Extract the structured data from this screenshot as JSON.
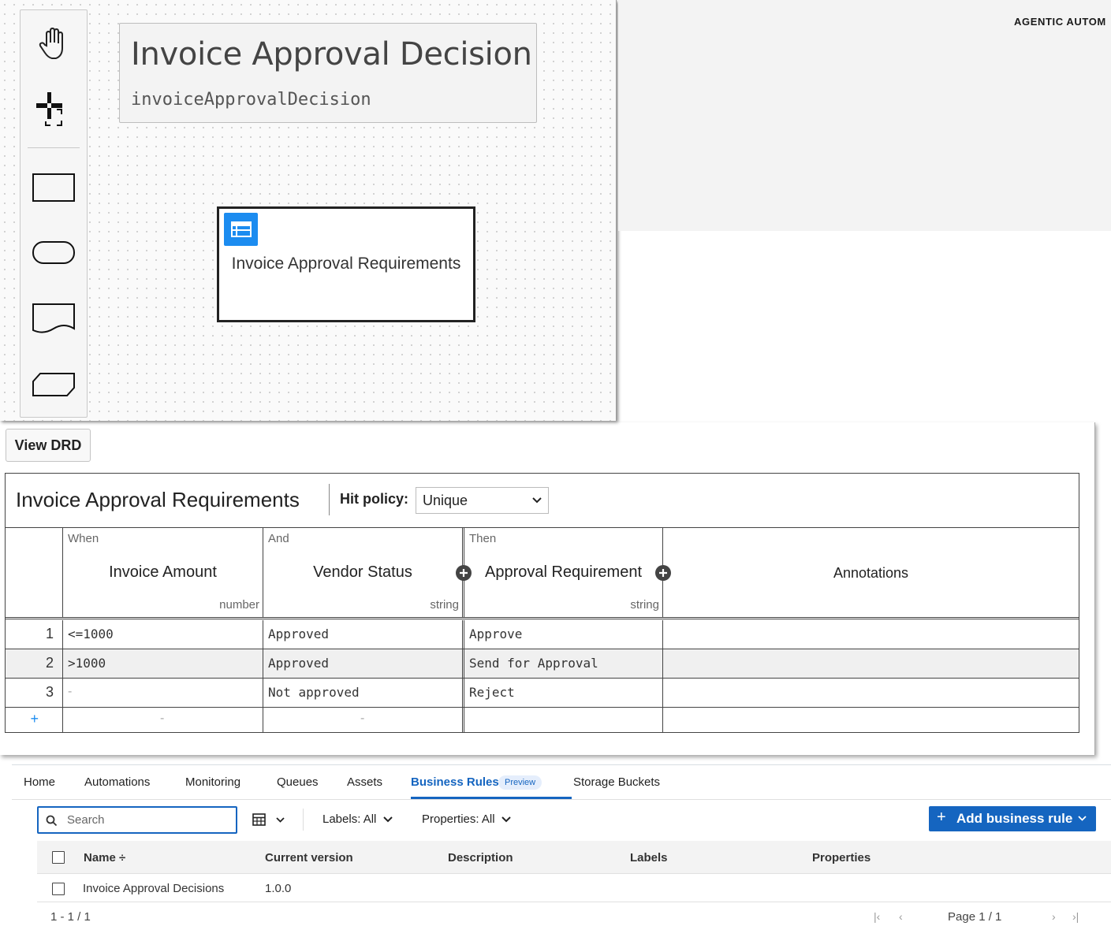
{
  "brand": {
    "tagline": "AGENTIC AUTOM"
  },
  "drd": {
    "definition_name": "Invoice Approval Decision",
    "definition_id": "invoiceApprovalDecision",
    "decision_label": "Invoice Approval Requirements"
  },
  "palette": {
    "tools": [
      "hand-tool-icon",
      "lasso-tool-icon",
      "decision-shape-icon",
      "input-data-shape-icon",
      "knowledge-source-shape-icon",
      "business-knowledge-shape-icon"
    ]
  },
  "view_drd_label": "View DRD",
  "decision_table": {
    "name": "Invoice Approval Requirements",
    "hit_policy_label": "Hit policy:",
    "hit_policy_value": "Unique",
    "columns": [
      {
        "kind": "When",
        "title": "Invoice Amount",
        "type": "number"
      },
      {
        "kind": "And",
        "title": "Vendor Status",
        "type": "string"
      },
      {
        "kind": "Then",
        "title": "Approval Requirement",
        "type": "string"
      },
      {
        "kind": "",
        "title": "Annotations",
        "type": ""
      }
    ],
    "rows": [
      {
        "index": "1",
        "cells": [
          "<=1000",
          "Approved",
          "Approve",
          ""
        ]
      },
      {
        "index": "2",
        "cells": [
          ">1000",
          "Approved",
          "Send for Approval",
          ""
        ]
      },
      {
        "index": "3",
        "cells": [
          "-",
          "Not approved",
          "Reject",
          ""
        ]
      }
    ],
    "add_row_symbol": "+",
    "empty_placeholder": "-"
  },
  "orchestrator": {
    "tabs": [
      "Home",
      "Automations",
      "Monitoring",
      "Queues",
      "Assets",
      "Business Rules",
      "Storage Buckets"
    ],
    "active_tab": "Business Rules",
    "preview_badge": "Preview",
    "search_placeholder": "Search",
    "labels_filter": "Labels: All",
    "properties_filter": "Properties: All",
    "add_button": "Add business rule",
    "columns": [
      "Name ÷",
      "Current version",
      "Description",
      "Labels",
      "Properties"
    ],
    "rows": [
      {
        "name": "Invoice Approval Decisions",
        "version": "1.0.0",
        "description": "",
        "labels": "",
        "properties": ""
      }
    ],
    "count": "1 - 1 / 1",
    "page": "Page 1 / 1"
  },
  "colors": {
    "accent": "#1565c0",
    "decision_icon": "#1c8cf0"
  }
}
